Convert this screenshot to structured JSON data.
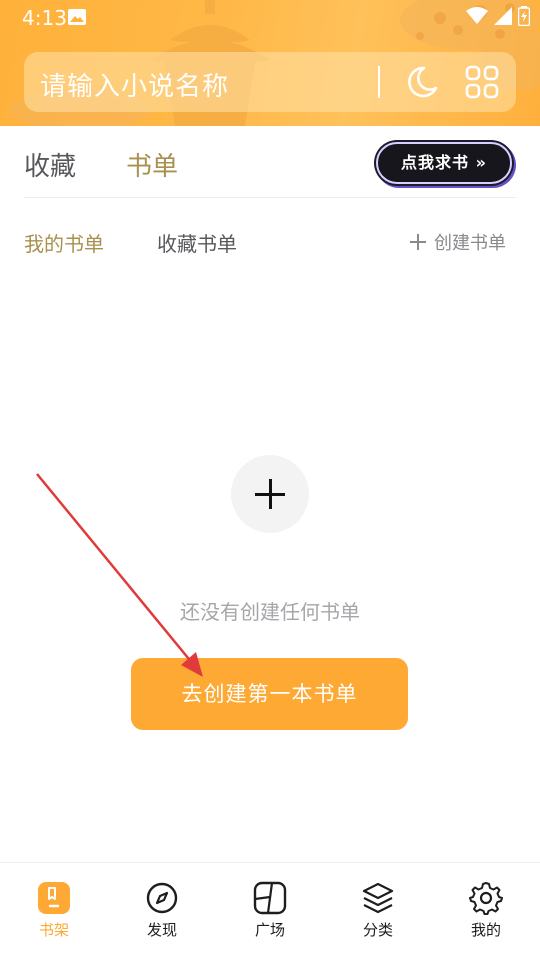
{
  "status_bar": {
    "time": "4:13"
  },
  "search": {
    "placeholder": "请输入小说名称"
  },
  "tabs": {
    "shoucang": "收藏",
    "shudan": "书单",
    "cta": "点我求书 »"
  },
  "subtabs": {
    "mine": "我的书单",
    "fav": "收藏书单",
    "create": "创建书单"
  },
  "empty": {
    "message": "还没有创建任何书单",
    "button": "去创建第一本书单"
  },
  "bottom_nav": [
    {
      "label": "书架",
      "icon": "bookshelf-icon",
      "active": true
    },
    {
      "label": "发现",
      "icon": "compass-icon",
      "active": false
    },
    {
      "label": "广场",
      "icon": "square-icon",
      "active": false
    },
    {
      "label": "分类",
      "icon": "layers-icon",
      "active": false
    },
    {
      "label": "我的",
      "icon": "gear-icon",
      "active": false
    }
  ],
  "colors": {
    "accent": "#fea934",
    "active_tab": "#a8914e",
    "header": "#ffb13a",
    "arrow": "#e03a3a"
  }
}
